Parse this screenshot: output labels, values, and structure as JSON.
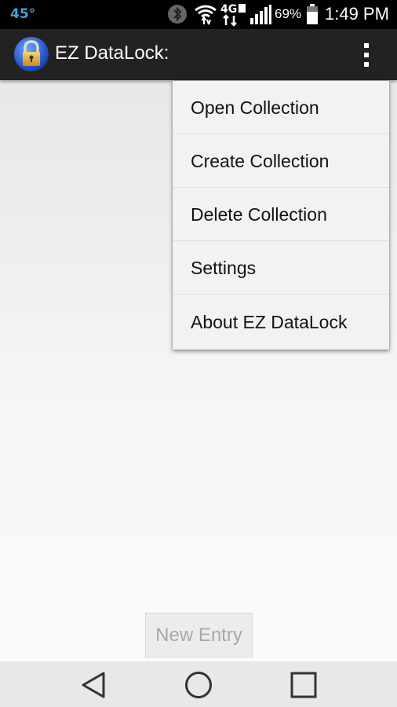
{
  "status_bar": {
    "temperature": "45°",
    "battery_percent": "69%",
    "battery_level": 0.69,
    "time": "1:49 PM",
    "network_label": "4G",
    "icons": [
      "bluetooth-icon",
      "wifi-icon",
      "lte-icon",
      "signal-icon",
      "battery-icon"
    ]
  },
  "app_bar": {
    "title": "EZ DataLock:",
    "app_icon": "padlock-icon",
    "overflow_icon": "overflow-menu-icon"
  },
  "menu": {
    "items": [
      {
        "label": "Open Collection"
      },
      {
        "label": "Create Collection"
      },
      {
        "label": "Delete Collection"
      },
      {
        "label": "Settings"
      },
      {
        "label": "About EZ DataLock"
      }
    ]
  },
  "main": {
    "new_entry_label": "New Entry"
  },
  "nav_bar": {
    "icons": [
      "back-icon",
      "home-icon",
      "recents-icon"
    ]
  },
  "colors": {
    "status_bar_bg": "#000000",
    "app_bar_bg": "#222222",
    "temperature": "#43a0d6",
    "menu_bg": "#f2f2f2",
    "disabled_text": "#a9a9a9"
  }
}
